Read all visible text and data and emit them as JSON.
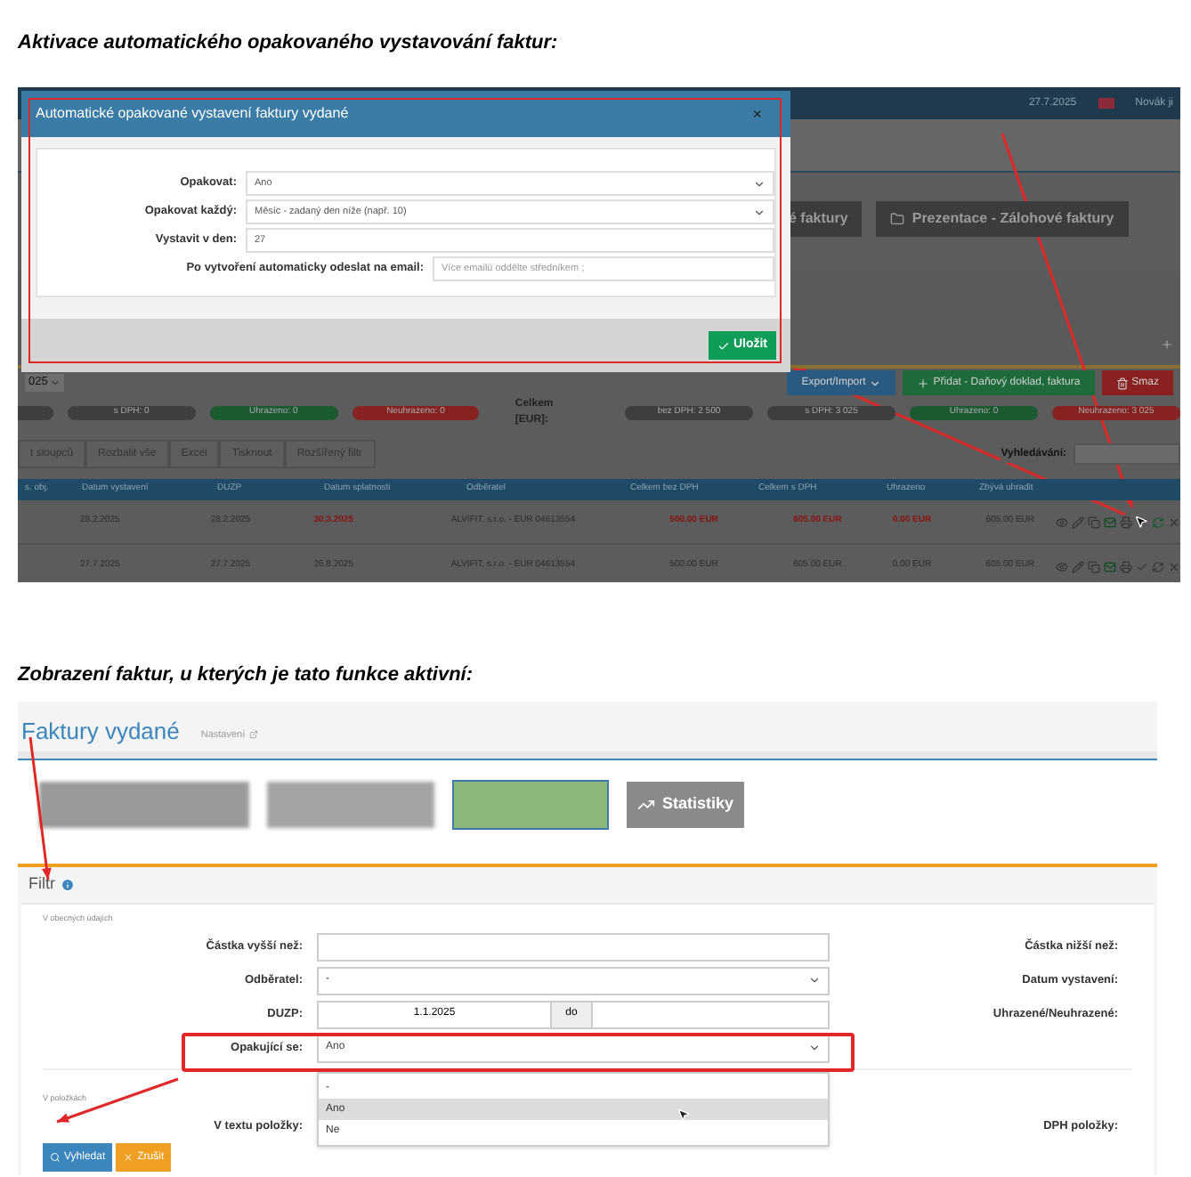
{
  "heading_1": "Aktivace automatického opakovaného vystavování faktur:",
  "screenshot_1": {
    "top_bar": {
      "date": "27.7.2025",
      "user": "Novák ji"
    },
    "buttons": [
      "é faktury",
      "Prezentace - Zálohové faktury"
    ],
    "year_select": "025",
    "actions": [
      {
        "label": "Export/Import",
        "kind": "dropdown",
        "color": "#2a5a80"
      },
      {
        "label": "Přidat - Daňový doklad, faktura",
        "kind": "add",
        "color": "#1d6b3a"
      },
      {
        "label": "Smaz",
        "kind": "delete",
        "color": "#8a2020"
      }
    ],
    "pills": [
      {
        "text": "s DPH: 0",
        "color": "#3e3e3e"
      },
      {
        "text": "Uhrazeno: 0",
        "color": "#1c5a32"
      },
      {
        "text": "Neuhrazeno: 0",
        "color": "#872222"
      }
    ],
    "total_label": "Celkem [EUR]:",
    "total_pills": [
      {
        "text": "bez DPH: 2 500",
        "color": "#3e3e3e"
      },
      {
        "text": "s DPH: 3 025",
        "color": "#3e3e3e"
      },
      {
        "text": "Uhrazeno: 0",
        "color": "#1c5a32"
      },
      {
        "text": "Neuhrazeno: 3 025",
        "color": "#872222"
      }
    ],
    "toolbar": [
      "t sloupců",
      "Rozbalit vše",
      "Excel",
      "Tisknout",
      "Rozšířený filtr"
    ],
    "search_label": "Vyhledávání:",
    "columns": [
      "s. obj.",
      "Datum vystavení",
      "DUZP",
      "Datum splatnosti",
      "Odběratel",
      "Celkem bez DPH",
      "Celkem s DPH",
      "Uhrazeno",
      "Zbývá uhradit"
    ],
    "rows": [
      {
        "cells": [
          "",
          "28.2.2025",
          "28.2.2025",
          "30.3.2025",
          "ALVIFIT, s.r.o. - EUR 04613554",
          "500.00 EUR",
          "605.00 EUR",
          "0.00 EUR",
          "605.00 EUR"
        ],
        "overdue": true,
        "recurring": true
      },
      {
        "cells": [
          "",
          "27.7.2025",
          "27.7.2025",
          "26.8.2025",
          "ALVIFIT, s.r.o. - EUR 04613554",
          "500.00 EUR",
          "605.00 EUR",
          "0.00 EUR",
          "605.00 EUR"
        ],
        "overdue": false,
        "recurring": false
      }
    ],
    "modal": {
      "title": "Automatické opakované vystavení faktury vydané",
      "close": "×",
      "fields": [
        {
          "label": "Opakovat:",
          "kind": "select",
          "value": "Ano"
        },
        {
          "label": "Opakovat každý:",
          "kind": "select",
          "value": "Měsíc - zadaný den níže (např. 10)"
        },
        {
          "label": "Vystavit v den:",
          "kind": "input",
          "value": "27"
        }
      ],
      "email_row": {
        "label": "Po vytvoření automaticky odeslat na email:",
        "placeholder": "Více emailů oddělte středníkem ;"
      },
      "save": "Uložit"
    }
  },
  "heading_2": "Zobrazení faktur, u kterých je tato funkce aktivní:",
  "screenshot_2": {
    "title": "Faktury vydané",
    "settings": "Nastavení",
    "stats_button": "Statistiky",
    "filter_title": "Filtr",
    "group_1": "V obecných údajích",
    "rows": [
      {
        "label": "Částka vyšší než:",
        "kind": "input",
        "value": "",
        "right_label": "Částka nižší než:"
      },
      {
        "label": "Odběratel:",
        "kind": "select",
        "value": "-",
        "right_label": "Datum vystavení:"
      },
      {
        "label": "DUZP:",
        "kind": "range",
        "value": "1.1.2025",
        "separator": "do",
        "right_label": "Uhrazené/Neuhrazené:"
      },
      {
        "label": "Opakující se:",
        "kind": "select",
        "value": "Ano"
      }
    ],
    "options": [
      {
        "text": "-",
        "selected": false
      },
      {
        "text": "Ano",
        "selected": true
      },
      {
        "text": "Ne",
        "selected": false
      }
    ],
    "group_2": "V položkách",
    "item_row": {
      "label": "V textu položky:",
      "right_label": "DPH položky:"
    },
    "search_button": "Vyhledat",
    "cancel_button": "Zrušit"
  }
}
